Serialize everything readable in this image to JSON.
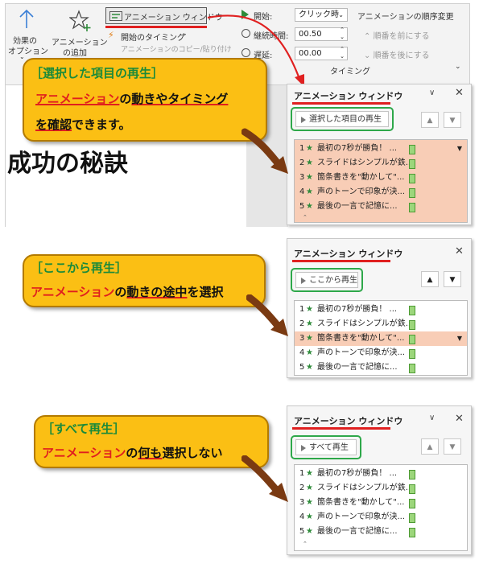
{
  "ribbon": {
    "effect_options_label_1": "効果の",
    "effect_options_label_2": "オプション",
    "add_animation_label_1": "アニメーション",
    "add_animation_label_2": "の追加",
    "animation_pane_button": "アニメーション ウィンドウ",
    "trigger_button": "開始のタイミング",
    "animation_painter_button": "アニメーションのコピー/貼り付け",
    "start_label": "開始:",
    "start_value": "クリック時",
    "duration_label": "継続時間:",
    "duration_value": "00.50",
    "delay_label": "遅延:",
    "delay_value": "00.00",
    "timing_group_label": "タイミング",
    "reorder_label": "アニメーションの順序変更",
    "move_earlier": "順番を前にする",
    "move_later": "順番を後にする"
  },
  "slide": {
    "title_text": "成功の秘訣"
  },
  "panels": [
    {
      "title": "アニメーション ウィンドウ",
      "play_button": "選択した項目の再生",
      "selected_index": -1,
      "items": [
        {
          "num": "1",
          "text": "最初の7秒が勝負！ ..."
        },
        {
          "num": "2",
          "text": "スライドはシンプルが鉄..."
        },
        {
          "num": "3",
          "text": "箇条書きを\"動かして\"..."
        },
        {
          "num": "4",
          "text": "声のトーンで印象が決..."
        },
        {
          "num": "5",
          "text": "最後の一言で記憶に..."
        }
      ]
    },
    {
      "title": "アニメーション ウィンドウ",
      "play_button": "ここから再生",
      "selected_index": 2,
      "items": [
        {
          "num": "1",
          "text": "最初の7秒が勝負！ ..."
        },
        {
          "num": "2",
          "text": "スライドはシンプルが鉄..."
        },
        {
          "num": "3",
          "text": "箇条書きを\"動かして\"..."
        },
        {
          "num": "4",
          "text": "声のトーンで印象が決..."
        },
        {
          "num": "5",
          "text": "最後の一言で記憶に..."
        }
      ]
    },
    {
      "title": "アニメーション ウィンドウ",
      "play_button": "すべて再生",
      "selected_index": -1,
      "items": [
        {
          "num": "1",
          "text": "最初の7秒が勝負！ ..."
        },
        {
          "num": "2",
          "text": "スライドはシンプルが鉄..."
        },
        {
          "num": "3",
          "text": "箇条書きを\"動かして\"..."
        },
        {
          "num": "4",
          "text": "声のトーンで印象が決..."
        },
        {
          "num": "5",
          "text": "最後の一言で記憶に..."
        }
      ]
    }
  ],
  "callouts": [
    {
      "title": "［選択した項目の再生］",
      "line1_red": "アニメーション",
      "line1_mid": "の",
      "line1_ul": "動きやタイミング",
      "line2_ul": "を確認",
      "line2_rest": "できます。"
    },
    {
      "title": "［ここから再生］",
      "line1_red": "アニメーション",
      "line1_mid": "の",
      "line1_ul": "動きの途中",
      "line1_rest": "を選択"
    },
    {
      "title": "［すべて再生］",
      "line1_red": "アニメーション",
      "line1_mid": "の",
      "line1_ul": "何も",
      "line1_rest": "選択しない"
    }
  ],
  "icons": {
    "star": "★",
    "arrow_up": "▲",
    "arrow_down": "▼",
    "close": "✕",
    "chevron": "∨",
    "collapse": "⌃"
  },
  "colors": {
    "callout_fill": "#fbbf14",
    "selected_row": "#f8cdb6",
    "highlight_red": "#e01e1e",
    "frame_green": "#2ea84a",
    "pointer_arrow": "#7a3a12"
  }
}
